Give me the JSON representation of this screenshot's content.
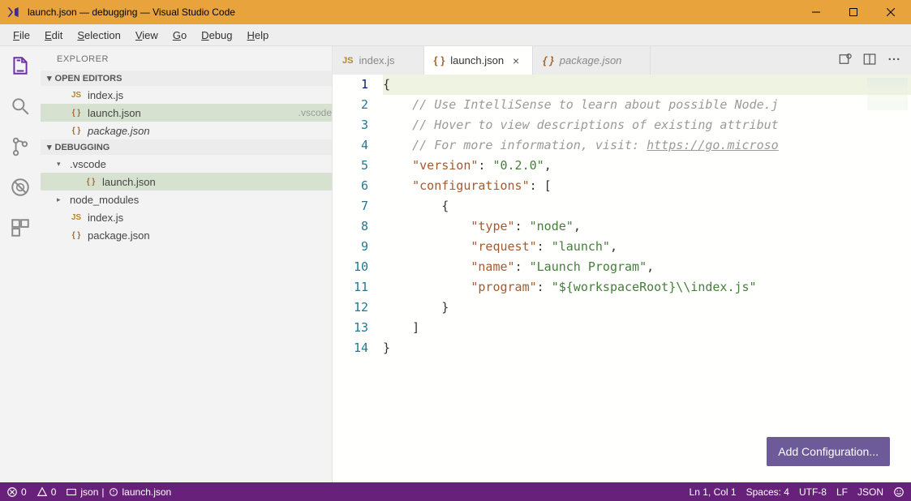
{
  "window": {
    "title": "launch.json — debugging — Visual Studio Code"
  },
  "menu": [
    "File",
    "Edit",
    "Selection",
    "View",
    "Go",
    "Debug",
    "Help"
  ],
  "menu_accel": [
    "F",
    "E",
    "S",
    "V",
    "G",
    "D",
    "H"
  ],
  "sidebar": {
    "title": "EXPLORER",
    "sections": {
      "open_editors": {
        "label": "OPEN EDITORS",
        "items": [
          {
            "icon": "js",
            "name": "index.js",
            "meta": "",
            "active": false,
            "italic": false
          },
          {
            "icon": "json",
            "name": "launch.json",
            "meta": ".vscode",
            "active": true,
            "italic": false
          },
          {
            "icon": "json",
            "name": "package.json",
            "meta": "",
            "active": false,
            "italic": true
          }
        ]
      },
      "folder": {
        "label": "DEBUGGING",
        "tree": [
          {
            "kind": "folder",
            "twisty": "▾",
            "name": ".vscode",
            "indent": 1
          },
          {
            "kind": "file",
            "icon": "json",
            "name": "launch.json",
            "indent": 2,
            "active": true
          },
          {
            "kind": "folder",
            "twisty": "▸",
            "name": "node_modules",
            "indent": 1
          },
          {
            "kind": "file",
            "icon": "js",
            "name": "index.js",
            "indent": 1
          },
          {
            "kind": "file",
            "icon": "json",
            "name": "package.json",
            "indent": 1
          }
        ]
      }
    }
  },
  "tabs": [
    {
      "icon": "js",
      "label": "index.js",
      "active": false,
      "dirty": false,
      "italic": false
    },
    {
      "icon": "json",
      "label": "launch.json",
      "active": true,
      "dirty": false,
      "italic": false
    },
    {
      "icon": "json",
      "label": "package.json",
      "active": false,
      "dirty": false,
      "italic": true
    }
  ],
  "editor": {
    "lines": [
      {
        "n": 1,
        "hl": true,
        "tokens": [
          {
            "t": "{",
            "c": "brace"
          }
        ]
      },
      {
        "n": 2,
        "tokens": [
          {
            "t": "    ",
            "c": ""
          },
          {
            "t": "// Use IntelliSense to learn about possible Node.j",
            "c": "comment"
          }
        ]
      },
      {
        "n": 3,
        "tokens": [
          {
            "t": "    ",
            "c": ""
          },
          {
            "t": "// Hover to view descriptions of existing attribut",
            "c": "comment"
          }
        ]
      },
      {
        "n": 4,
        "tokens": [
          {
            "t": "    ",
            "c": ""
          },
          {
            "t": "// For more information, visit: ",
            "c": "comment"
          },
          {
            "t": "https://go.microso",
            "c": "comment link"
          }
        ]
      },
      {
        "n": 5,
        "tokens": [
          {
            "t": "    ",
            "c": ""
          },
          {
            "t": "\"version\"",
            "c": "key"
          },
          {
            "t": ": ",
            "c": "punc"
          },
          {
            "t": "\"0.2.0\"",
            "c": "string"
          },
          {
            "t": ",",
            "c": "punc"
          }
        ]
      },
      {
        "n": 6,
        "tokens": [
          {
            "t": "    ",
            "c": ""
          },
          {
            "t": "\"configurations\"",
            "c": "key"
          },
          {
            "t": ": [",
            "c": "punc"
          }
        ]
      },
      {
        "n": 7,
        "tokens": [
          {
            "t": "        {",
            "c": "punc"
          }
        ]
      },
      {
        "n": 8,
        "tokens": [
          {
            "t": "            ",
            "c": ""
          },
          {
            "t": "\"type\"",
            "c": "key"
          },
          {
            "t": ": ",
            "c": "punc"
          },
          {
            "t": "\"node\"",
            "c": "string"
          },
          {
            "t": ",",
            "c": "punc"
          }
        ]
      },
      {
        "n": 9,
        "tokens": [
          {
            "t": "            ",
            "c": ""
          },
          {
            "t": "\"request\"",
            "c": "key"
          },
          {
            "t": ": ",
            "c": "punc"
          },
          {
            "t": "\"launch\"",
            "c": "string"
          },
          {
            "t": ",",
            "c": "punc"
          }
        ]
      },
      {
        "n": 10,
        "tokens": [
          {
            "t": "            ",
            "c": ""
          },
          {
            "t": "\"name\"",
            "c": "key"
          },
          {
            "t": ": ",
            "c": "punc"
          },
          {
            "t": "\"Launch Program\"",
            "c": "string"
          },
          {
            "t": ",",
            "c": "punc"
          }
        ]
      },
      {
        "n": 11,
        "tokens": [
          {
            "t": "            ",
            "c": ""
          },
          {
            "t": "\"program\"",
            "c": "key"
          },
          {
            "t": ": ",
            "c": "punc"
          },
          {
            "t": "\"${workspaceRoot}\\\\index.js\"",
            "c": "string"
          }
        ]
      },
      {
        "n": 12,
        "tokens": [
          {
            "t": "        }",
            "c": "punc"
          }
        ]
      },
      {
        "n": 13,
        "tokens": [
          {
            "t": "    ]",
            "c": "punc"
          }
        ]
      },
      {
        "n": 14,
        "tokens": [
          {
            "t": "}",
            "c": "brace"
          }
        ]
      }
    ],
    "button": "Add Configuration..."
  },
  "status": {
    "errors": "0",
    "warnings": "0",
    "lang_server": "json",
    "schema": "launch.json",
    "cursor": "Ln 1, Col 1",
    "indent": "Spaces: 4",
    "encoding": "UTF-8",
    "eol": "LF",
    "lang": "JSON"
  }
}
